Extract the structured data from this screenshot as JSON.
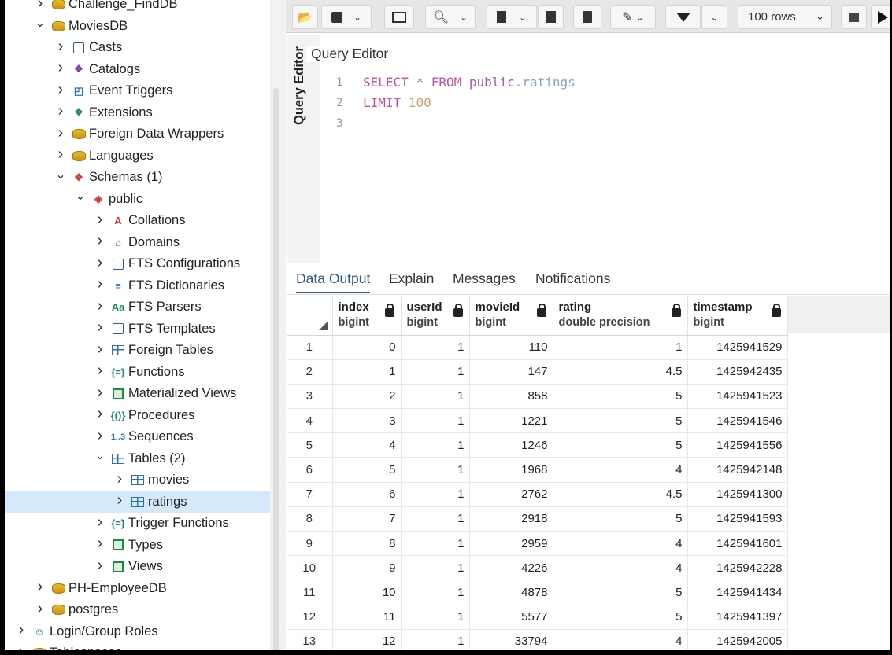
{
  "tree": {
    "items": [
      {
        "label": "Challenge_FindDB",
        "level": 2,
        "chev": "right",
        "icon": "database-icon"
      },
      {
        "label": "MoviesDB",
        "level": 2,
        "chev": "down",
        "icon": "database-icon"
      },
      {
        "label": "Casts",
        "level": 3,
        "chev": "right",
        "icon": "casts-icon"
      },
      {
        "label": "Catalogs",
        "level": 3,
        "chev": "right",
        "icon": "catalogs-icon"
      },
      {
        "label": "Event Triggers",
        "level": 3,
        "chev": "right",
        "icon": "event-trigger-icon"
      },
      {
        "label": "Extensions",
        "level": 3,
        "chev": "right",
        "icon": "extension-icon"
      },
      {
        "label": "Foreign Data Wrappers",
        "level": 3,
        "chev": "right",
        "icon": "foreign-data-wrapper-icon"
      },
      {
        "label": "Languages",
        "level": 3,
        "chev": "right",
        "icon": "language-icon"
      },
      {
        "label": "Schemas (1)",
        "level": 3,
        "chev": "down",
        "icon": "schemas-icon"
      },
      {
        "label": "public",
        "level": 4,
        "chev": "down",
        "icon": "schema-icon"
      },
      {
        "label": "Collations",
        "level": 5,
        "chev": "right",
        "icon": "collation-icon"
      },
      {
        "label": "Domains",
        "level": 5,
        "chev": "right",
        "icon": "domain-icon"
      },
      {
        "label": "FTS Configurations",
        "level": 5,
        "chev": "right",
        "icon": "fts-configuration-icon"
      },
      {
        "label": "FTS Dictionaries",
        "level": 5,
        "chev": "right",
        "icon": "fts-dictionary-icon"
      },
      {
        "label": "FTS Parsers",
        "level": 5,
        "chev": "right",
        "icon": "fts-parser-icon"
      },
      {
        "label": "FTS Templates",
        "level": 5,
        "chev": "right",
        "icon": "fts-template-icon"
      },
      {
        "label": "Foreign Tables",
        "level": 5,
        "chev": "right",
        "icon": "foreign-table-icon"
      },
      {
        "label": "Functions",
        "level": 5,
        "chev": "right",
        "icon": "function-icon"
      },
      {
        "label": "Materialized Views",
        "level": 5,
        "chev": "right",
        "icon": "materialized-view-icon"
      },
      {
        "label": "Procedures",
        "level": 5,
        "chev": "right",
        "icon": "procedure-icon"
      },
      {
        "label": "Sequences",
        "level": 5,
        "chev": "right",
        "icon": "sequence-icon"
      },
      {
        "label": "Tables (2)",
        "level": 5,
        "chev": "down",
        "icon": "tables-icon"
      },
      {
        "label": "movies",
        "level": 6,
        "chev": "right",
        "icon": "table-icon"
      },
      {
        "label": "ratings",
        "level": 6,
        "chev": "right",
        "icon": "table-icon",
        "selected": true
      },
      {
        "label": "Trigger Functions",
        "level": 5,
        "chev": "right",
        "icon": "trigger-function-icon"
      },
      {
        "label": "Types",
        "level": 5,
        "chev": "right",
        "icon": "type-icon"
      },
      {
        "label": "Views",
        "level": 5,
        "chev": "right",
        "icon": "view-icon"
      },
      {
        "label": "PH-EmployeeDB",
        "level": 2,
        "chev": "right",
        "icon": "database-disconnected-icon"
      },
      {
        "label": "postgres",
        "level": 2,
        "chev": "right",
        "icon": "database-icon"
      },
      {
        "label": "Login/Group Roles",
        "level": 1,
        "chev": "right",
        "icon": "login-roles-icon"
      },
      {
        "label": "Tablespaces",
        "level": 1,
        "chev": "right",
        "icon": "tablespace-icon"
      }
    ]
  },
  "toolbar": {
    "rows_select": "100 rows"
  },
  "editor": {
    "tab_label": "Query Editor",
    "title": "Query Editor",
    "line_numbers": [
      "1",
      "2",
      "3"
    ],
    "line1": {
      "kw1": "SELECT",
      "star": "*",
      "kw2": "FROM",
      "schema": "public",
      "dot": ".",
      "table": "ratings"
    },
    "line2": {
      "kw": "LIMIT",
      "num": "100"
    }
  },
  "tabs": [
    "Data Output",
    "Explain",
    "Messages",
    "Notifications"
  ],
  "grid": {
    "columns": [
      {
        "name": "index",
        "type": "bigint"
      },
      {
        "name": "userId",
        "type": "bigint"
      },
      {
        "name": "movieId",
        "type": "bigint"
      },
      {
        "name": "rating",
        "type": "double precision"
      },
      {
        "name": "timestamp",
        "type": "bigint"
      }
    ],
    "rows": [
      [
        "1",
        "0",
        "1",
        "110",
        "1",
        "1425941529"
      ],
      [
        "2",
        "1",
        "1",
        "147",
        "4.5",
        "1425942435"
      ],
      [
        "3",
        "2",
        "1",
        "858",
        "5",
        "1425941523"
      ],
      [
        "4",
        "3",
        "1",
        "1221",
        "5",
        "1425941546"
      ],
      [
        "5",
        "4",
        "1",
        "1246",
        "5",
        "1425941556"
      ],
      [
        "6",
        "5",
        "1",
        "1968",
        "4",
        "1425942148"
      ],
      [
        "7",
        "6",
        "1",
        "2762",
        "4.5",
        "1425941300"
      ],
      [
        "8",
        "7",
        "1",
        "2918",
        "5",
        "1425941593"
      ],
      [
        "9",
        "8",
        "1",
        "2959",
        "4",
        "1425941601"
      ],
      [
        "10",
        "9",
        "1",
        "4226",
        "4",
        "1425942228"
      ],
      [
        "11",
        "10",
        "1",
        "4878",
        "5",
        "1425941434"
      ],
      [
        "12",
        "11",
        "1",
        "5577",
        "5",
        "1425941397"
      ],
      [
        "13",
        "12",
        "1",
        "33794",
        "4",
        "1425942005"
      ]
    ]
  }
}
